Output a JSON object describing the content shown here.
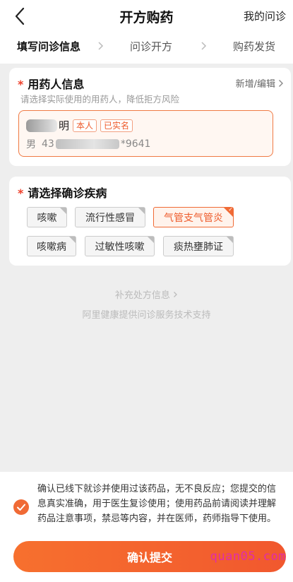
{
  "header": {
    "title": "开方购药",
    "right_link": "我的问诊"
  },
  "steps": [
    {
      "label": "填写问诊信息",
      "active": true
    },
    {
      "label": "问诊开方",
      "active": false
    },
    {
      "label": "购药发货",
      "active": false
    }
  ],
  "patient_card": {
    "required_mark": "*",
    "title": "用药人信息",
    "subtitle": "请选择实际使用的用药人，降低拒方风险",
    "add_edit": "新增/编辑",
    "patient": {
      "name_visible": "明",
      "tags": [
        "本人",
        "已实名"
      ],
      "gender": "男",
      "phone_prefix": "43",
      "phone_suffix": "*9641"
    }
  },
  "disease_card": {
    "required_mark": "*",
    "title": "请选择确诊疾病",
    "diseases": [
      {
        "label": "咳嗽",
        "selected": false
      },
      {
        "label": "流行性感冒",
        "selected": false
      },
      {
        "label": "气管支气管炎",
        "selected": true
      },
      {
        "label": "咳嗽病",
        "selected": false
      },
      {
        "label": "过敏性咳嗽",
        "selected": false
      },
      {
        "label": "痰热壅肺证",
        "selected": false
      }
    ]
  },
  "supplement_link": "补充处方信息",
  "support_text": "阿里健康提供问诊服务技术支持",
  "consent": {
    "checked": true,
    "text": "确认已线下就诊并使用过该药品，无不良反应；您提交的信息真实准确，用于医生复诊使用；使用药品前请阅读并理解药品注意事项，禁忌等内容，并在医师，药师指导下使用。"
  },
  "submit_label": "确认提交",
  "watermark": "quan05.com",
  "colors": {
    "accent": "#f06a35",
    "required": "#ee3f2a"
  }
}
